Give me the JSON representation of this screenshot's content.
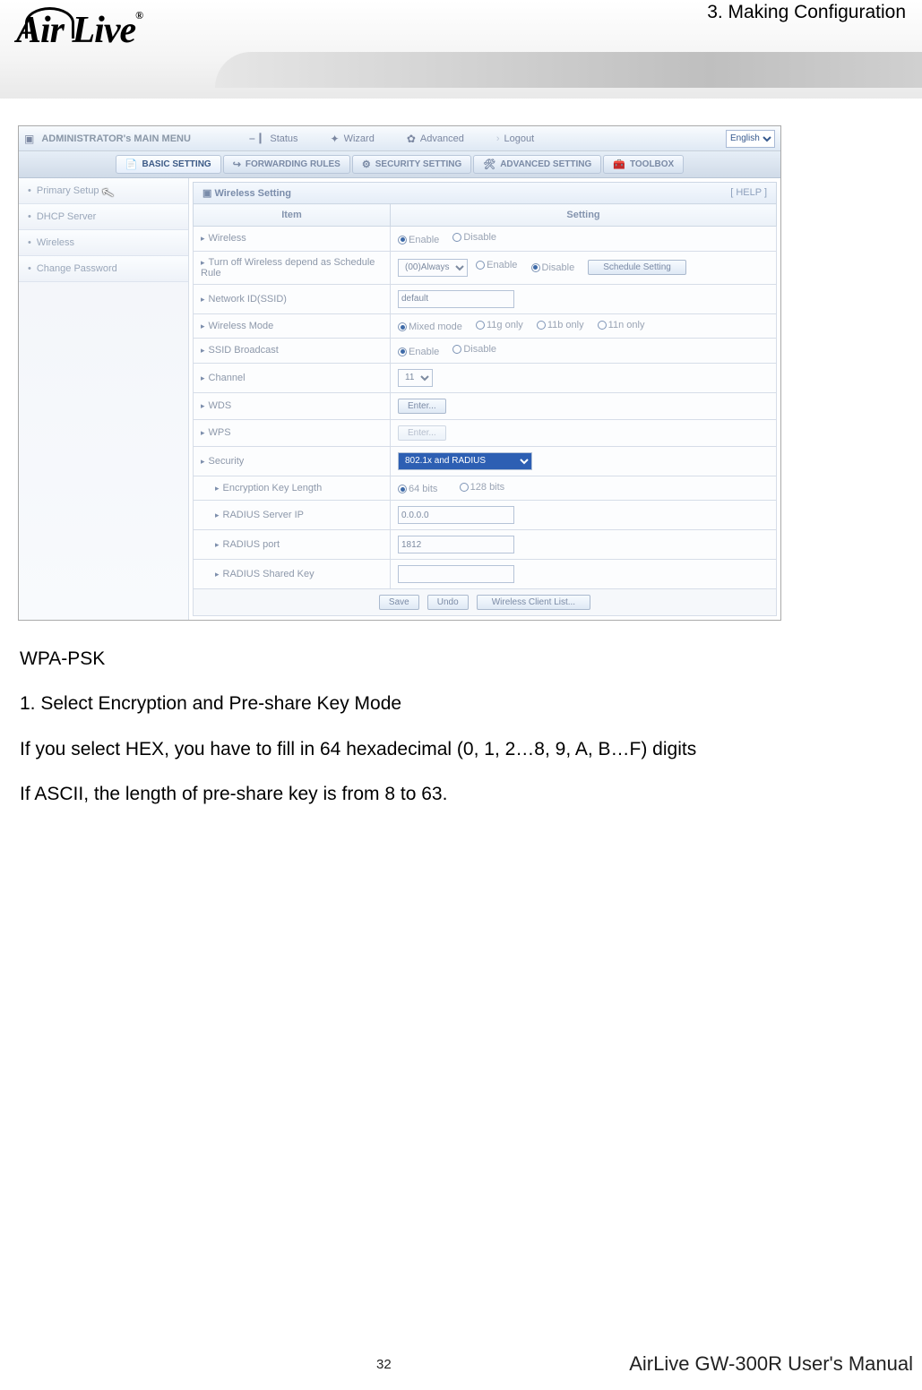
{
  "header": {
    "logo_text": "Air Live",
    "chapter": "3. Making Configuration"
  },
  "screenshot": {
    "admin_title": "ADMINISTRATOR's MAIN MENU",
    "nav": {
      "status": "Status",
      "wizard": "Wizard",
      "advanced": "Advanced",
      "logout": "Logout"
    },
    "lang_selected": "English",
    "tabs": {
      "basic": "BASIC SETTING",
      "forwarding": "FORWARDING RULES",
      "security": "SECURITY SETTING",
      "advanced": "ADVANCED SETTING",
      "toolbox": "TOOLBOX"
    },
    "sidebar": {
      "items": [
        {
          "label": "Primary Setup"
        },
        {
          "label": "DHCP Server"
        },
        {
          "label": "Wireless"
        },
        {
          "label": "Change Password"
        }
      ]
    },
    "panel": {
      "title": "Wireless Setting",
      "help": "[ HELP ]",
      "col_item": "Item",
      "col_setting": "Setting"
    },
    "rows": {
      "wireless": {
        "label": "Wireless",
        "enable": "Enable",
        "disable": "Disable"
      },
      "sched": {
        "label": "Turn off Wireless depend as Schedule Rule",
        "selected": "(00)Always",
        "enable": "Enable",
        "disable": "Disable",
        "btn": "Schedule Setting"
      },
      "ssid": {
        "label": "Network ID(SSID)",
        "value": "default"
      },
      "mode": {
        "label": "Wireless Mode",
        "mixed": "Mixed mode",
        "g": "11g only",
        "b": "11b only",
        "n": "11n only"
      },
      "broadcast": {
        "label": "SSID Broadcast",
        "enable": "Enable",
        "disable": "Disable"
      },
      "channel": {
        "label": "Channel",
        "value": "11"
      },
      "wds": {
        "label": "WDS",
        "btn": "Enter..."
      },
      "wps": {
        "label": "WPS",
        "btn": "Enter..."
      },
      "security": {
        "label": "Security",
        "value": "802.1x and RADIUS"
      },
      "keylen": {
        "label": "Encryption Key Length",
        "a": "64 bits",
        "b": "128 bits"
      },
      "radius_ip": {
        "label": "RADIUS Server IP",
        "value": "0.0.0.0"
      },
      "radius_port": {
        "label": "RADIUS port",
        "value": "1812"
      },
      "radius_key": {
        "label": "RADIUS Shared Key",
        "value": ""
      }
    },
    "buttons": {
      "save": "Save",
      "undo": "Undo",
      "client_list": "Wireless Client List..."
    }
  },
  "body": {
    "l1": "WPA-PSK",
    "l2": "1. Select Encryption and Pre-share Key Mode",
    "l3": "If you select HEX, you have to fill in 64 hexadecimal (0, 1, 2…8, 9, A, B…F) digits",
    "l4": "If ASCII, the length of pre-share key is from 8 to 63."
  },
  "footer": {
    "page": "32",
    "manual": "AirLive GW-300R User's Manual"
  }
}
